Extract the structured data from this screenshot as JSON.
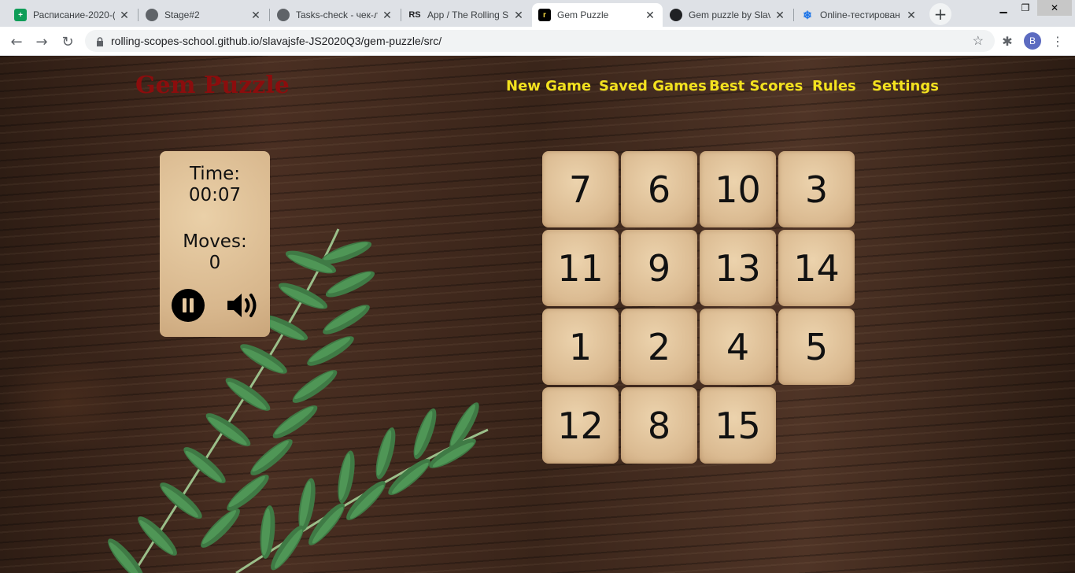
{
  "browser": {
    "tabs": [
      {
        "title": "Расписание-2020-(",
        "icon": "sheets-icon",
        "color": "#0f9d58"
      },
      {
        "title": "Stage#2",
        "icon": "globe-icon",
        "color": "#5f6368"
      },
      {
        "title": "Tasks-check - чек-л",
        "icon": "globe-icon",
        "color": "#5f6368"
      },
      {
        "title": "App / The Rolling S",
        "icon": "rs-icon",
        "color": "#202124"
      },
      {
        "title": "Gem Puzzle",
        "icon": "rs-school-icon",
        "color": "#000000",
        "active": true
      },
      {
        "title": "Gem puzzle by Slav",
        "icon": "github-icon",
        "color": "#202124"
      },
      {
        "title": "Online-тестирован",
        "icon": "snowflake-icon",
        "color": "#1a73e8"
      }
    ],
    "url": "rolling-scopes-school.github.io/slavajsfe-JS2020Q3/gem-puzzle/src/",
    "profile_initial": "B"
  },
  "app": {
    "title": "Gem Puzzle",
    "nav": [
      "New Game",
      "Saved Games",
      "Best Scores",
      "Rules",
      "Settings"
    ],
    "stats": {
      "time_label": "Time:",
      "time_value": "00:07",
      "moves_label": "Moves:",
      "moves_value": "0"
    },
    "board": {
      "size": 4,
      "tiles": [
        "7",
        "6",
        "10",
        "3",
        "11",
        "9",
        "13",
        "14",
        "1",
        "2",
        "4",
        "5",
        "12",
        "8",
        "15",
        ""
      ]
    }
  },
  "colors": {
    "title": "#8b0d0d",
    "nav": "#f3e21f",
    "tile": "#dbbb92"
  }
}
